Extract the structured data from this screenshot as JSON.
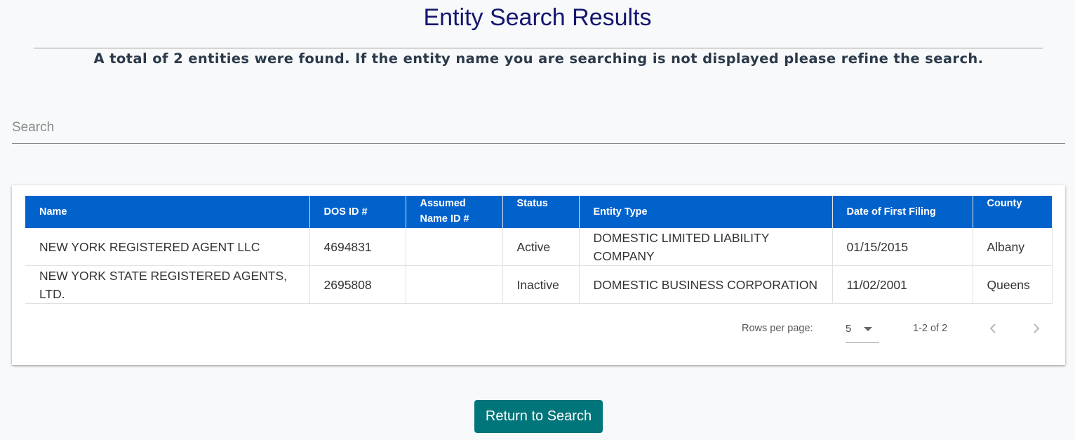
{
  "header": {
    "title": "Entity Search Results",
    "summary": "A total of 2 entities were found. If the entity name you are searching is not displayed please refine the search."
  },
  "search": {
    "placeholder": "Search",
    "value": ""
  },
  "table": {
    "header_color": "#0262cc",
    "columns": [
      {
        "label": "Name"
      },
      {
        "label": "DOS ID #"
      },
      {
        "label": "Assumed Name ID #"
      },
      {
        "label": "Status"
      },
      {
        "label": "Entity Type"
      },
      {
        "label": "Date of First Filing"
      },
      {
        "label": "County"
      }
    ],
    "rows": [
      {
        "name": "NEW YORK REGISTERED AGENT LLC",
        "dos_id": "4694831",
        "assumed_name_id": "",
        "status": "Active",
        "entity_type": "DOMESTIC LIMITED LIABILITY COMPANY",
        "date_first_filing": "01/15/2015",
        "county": "Albany"
      },
      {
        "name": "NEW YORK STATE REGISTERED AGENTS, LTD.",
        "dos_id": "2695808",
        "assumed_name_id": "",
        "status": "Inactive",
        "entity_type": "DOMESTIC BUSINESS CORPORATION",
        "date_first_filing": "11/02/2001",
        "county": "Queens"
      }
    ]
  },
  "pagination": {
    "rows_per_page_label": "Rows per page:",
    "rows_per_page_value": "5",
    "range_text": "1-2 of 2",
    "prev_icon": "chevron-left-icon",
    "next_icon": "chevron-right-icon"
  },
  "actions": {
    "return_label": "Return to Search",
    "return_color": "#00757a"
  }
}
